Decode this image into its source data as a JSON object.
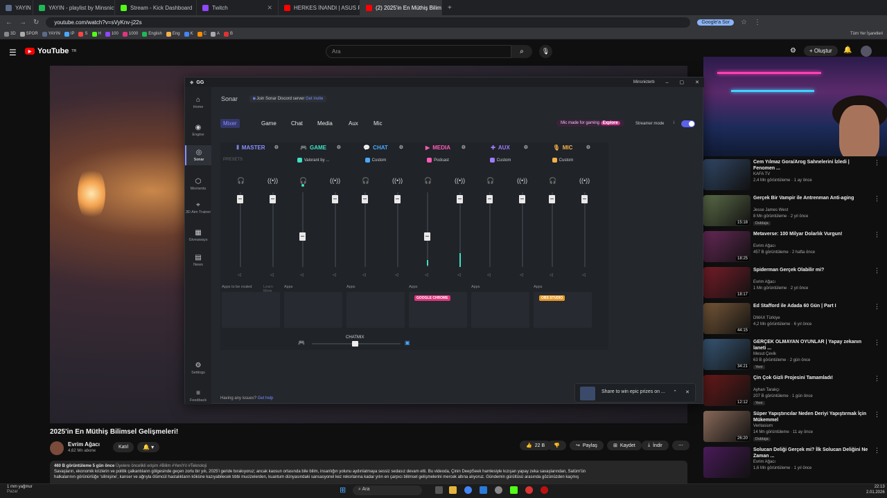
{
  "browser": {
    "tabs": [
      {
        "label": "YAYIN",
        "icon": "badge-icon",
        "color": "#5b6b8c"
      },
      {
        "label": "YAYIN - playlist by Minsnicterb",
        "icon": "spotify-icon",
        "color": "#1db954"
      },
      {
        "label": "Stream - Kick Dashboard",
        "icon": "kick-icon",
        "color": "#53fc18"
      },
      {
        "label": "Twitch",
        "icon": "twitch-icon",
        "color": "#9146ff"
      },
      {
        "label": "HERKES İNANDI | ASUS RAM V...",
        "icon": "youtube-icon",
        "color": "#ff0000"
      },
      {
        "label": "(2) 2025'in En Müthiş Bilim...",
        "icon": "youtube-icon",
        "color": "#ff0000"
      }
    ],
    "url": "youtube.com/watch?v=sVyKnv-j22s",
    "google_button": "Google'a Sor",
    "bookmarks": [
      "3D",
      "SPOR",
      "YAYIN",
      "IP",
      "S",
      "H",
      "100",
      "1000",
      "English",
      "Eng",
      "K",
      "C",
      "A",
      "B"
    ],
    "all_bookmarks": "Tüm Yer İşaretleri"
  },
  "youtube": {
    "logo": "YouTube",
    "country": "TR",
    "search_placeholder": "Ara",
    "create_label": "Oluştur",
    "video_title": "2025'in En Müthiş Bilimsel Gelişmeleri!",
    "channel_name": "Evrim Ağacı",
    "subscribers": "4,62 Mn abone",
    "join_label": "Katıl",
    "likes": "22 B",
    "share_label": "Paylaş",
    "save_label": "Kaydet",
    "download_label": "İndir",
    "description_meta": "460 B görüntüleme  5 gün önce",
    "description_tags": "Üyelere öncelikli erişim  #Bilim #YeniYıl #Teknoloji",
    "description_line1": "Savaşların, ekonomik krizlerin ve politik çalkantıların gölgesinde geçen zorlu bir yılı, 2025'i geride bırakıyoruz; ancak kaosun ortasında bile bilim, insanlığın yolunu aydınlatmaya sessiz sedasız devam etti. Bu videoda, Çinin DeepSeek hamlesiyle kızışan yapay zeka savaşlarından, Satürn'ün",
    "description_line2": "halkalarının görünürlüğe 'silinişine', kanser ve ağrıyla ölümcül hastalıkların köküne kazıyabilecek tıbbi mucizelerden, kuantum dünyasındaki sansasyonel kez rekorlarına kadar yılın en çarpıcı bilimsel gelişmelerini mercek altına alıyoruz. Gündemin gürültüsü arasında gözünüzden kaçmış",
    "recommendations": [
      {
        "title": "Cem Yılmaz Gora/Arog Sahnelerini İzledi | Fenomen ...",
        "channel": "KAFA TV",
        "meta": "2,4 Mn görüntüleme · 1 ay önce",
        "badge": "",
        "duration": "",
        "color": "#334a6a"
      },
      {
        "title": "Gerçek Bir Vampir ile Antrenman Anti-aging",
        "channel": "Jesse James West",
        "meta": "8 Mn görüntüleme · 2 yıl önce",
        "badge": "Dublaja",
        "duration": "15:18",
        "color": "#5e6f4a"
      },
      {
        "title": "Metaverse: 100 Milyar Dolarlık Vurgun!",
        "channel": "Evrim Ağacı",
        "meta": "457 B görüntüleme · 2 hafta önce",
        "badge": "",
        "duration": "18:25",
        "color": "#6a2a5a"
      },
      {
        "title": "Spiderman Gerçek Olabilir mi?",
        "channel": "Evrim Ağacı",
        "meta": "1 Mn görüntüleme · 2 yıl önce",
        "badge": "",
        "duration": "18:17",
        "color": "#7a1e2a"
      },
      {
        "title": "Ed Stafford ile Adada 60 Gün | Part I",
        "channel": "DMAX Türkiye",
        "meta": "4,2 Mn görüntüleme · 6 yıl önce",
        "badge": "",
        "duration": "44:15",
        "color": "#7a5a3a"
      },
      {
        "title": "GERÇEK OLMAYAN OYUNLAR | Yapay zekanın laneti ...",
        "channel": "Mesut Çevik",
        "meta": "63 B görüntüleme · 2 gün önce",
        "badge": "Yeni",
        "duration": "34:21",
        "color": "#3a5a7a"
      },
      {
        "title": "Çin Çok Gizli Projesini Tamamladı!",
        "channel": "Ayhan Tarakçı",
        "meta": "207 B görüntüleme · 1 gün önce",
        "badge": "Yeni",
        "duration": "12:12",
        "color": "#6a1a1a"
      },
      {
        "title": "Süper Yapıştırıcılar Neden Deriyi Yapıştırmak İçin Mükemmel",
        "channel": "Veritasium",
        "meta": "14 Mn görüntüleme · 11 ay önce",
        "badge": "Dublaja",
        "duration": "26:20",
        "color": "#8a6a5a"
      },
      {
        "title": "Solucan Deliği Gerçek mi? İlk Solucan Deliğini Ne Zaman ...",
        "channel": "Evrim Ağacı",
        "meta": "1,6 Mn görüntüleme · 1 yıl önce",
        "badge": "",
        "duration": "",
        "color": "#4a1a5a"
      }
    ]
  },
  "gg": {
    "app_title": "GG",
    "user": "Minsnicterb",
    "nav": [
      {
        "label": "Home",
        "icon": "home-icon",
        "glyph": "⌂"
      },
      {
        "label": "Engine",
        "icon": "engine-icon",
        "glyph": "◉"
      },
      {
        "label": "Sonar",
        "icon": "sonar-icon",
        "glyph": "◎"
      },
      {
        "label": "Moments",
        "icon": "moments-icon",
        "glyph": "⬡"
      },
      {
        "label": "3D Aim Trainer",
        "icon": "aim-icon",
        "glyph": "⌖"
      },
      {
        "label": "Giveaways",
        "icon": "giveaways-icon",
        "glyph": "▦"
      },
      {
        "label": "News",
        "icon": "news-icon",
        "glyph": "▤"
      },
      {
        "label": "Settings",
        "icon": "settings-icon",
        "glyph": "⚙"
      },
      {
        "label": "Feedback",
        "icon": "feedback-icon",
        "glyph": "≡"
      }
    ],
    "sonar_title": "Sonar",
    "discord_text": "Join Sonar Discord server",
    "discord_link": "Get invite",
    "tabs": [
      "Mixer",
      "Game",
      "Chat",
      "Media",
      "Aux",
      "Mic"
    ],
    "mic_promo": "Mic made for gaming",
    "mic_promo_link": "Explore",
    "streamer_mode": "Streamer mode",
    "channels": [
      {
        "name": "MASTER",
        "preset": "PRESETS",
        "color": "#8a8fff",
        "apps_label": "Apps to be routed",
        "learn": "Learn More",
        "chip": "",
        "chip_color": ""
      },
      {
        "name": "GAME",
        "preset": "Valorant by ...",
        "color": "#3ee0c4",
        "apps_label": "Apps",
        "learn": "",
        "chip": "",
        "chip_color": ""
      },
      {
        "name": "CHAT",
        "preset": "Custom",
        "color": "#4aa8ff",
        "apps_label": "Apps",
        "learn": "",
        "chip": "",
        "chip_color": ""
      },
      {
        "name": "MEDIA",
        "preset": "Podcast",
        "color": "#ff5ab4",
        "apps_label": "Apps",
        "learn": "",
        "chip": "GOOGLE CHROME",
        "chip_color": "#e0357e"
      },
      {
        "name": "AUX",
        "preset": "Custom",
        "color": "#a07bff",
        "apps_label": "Apps",
        "learn": "",
        "chip": "",
        "chip_color": ""
      },
      {
        "name": "MIC",
        "preset": "Custom",
        "color": "#f5b04a",
        "apps_label": "Apps",
        "learn": "",
        "chip": "OBS STUDIO",
        "chip_color": "#e89a2a"
      }
    ],
    "chatmix_label": "CHATMIX",
    "issues_text": "Having any issues?",
    "issues_link": "Get help",
    "toast_text": "Share to win epic prizes on ..."
  },
  "taskbar": {
    "weather": "1 mm yağmur",
    "weather_sub": "Pazar",
    "search": "Ara",
    "time": "22:13",
    "date": "2.01.2026"
  }
}
